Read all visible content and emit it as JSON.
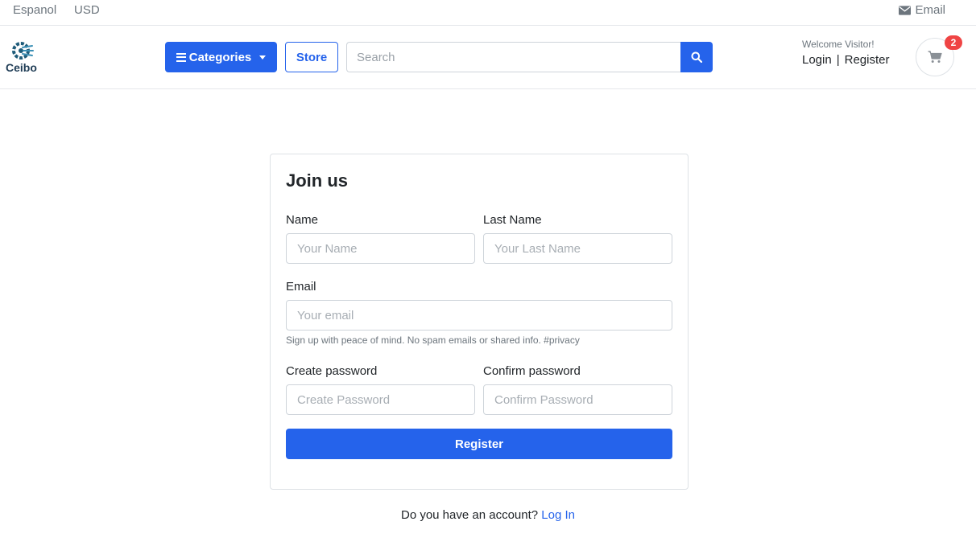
{
  "topbar": {
    "language": "Espanol",
    "currency": "USD",
    "email_label": "Email",
    "email_icon": "envelope-icon"
  },
  "header": {
    "logo_text": "Ceibo",
    "categories_label": "Categories",
    "store_label": "Store",
    "search_placeholder": "Search",
    "welcome_text": "Welcome Visitor!",
    "login_label": "Login",
    "separator": "|",
    "register_label": "Register",
    "cart_count": "2",
    "cart_icon": "shopping-cart-icon"
  },
  "form": {
    "title": "Join us",
    "name_label": "Name",
    "name_placeholder": "Your Name",
    "last_name_label": "Last Name",
    "last_name_placeholder": "Your Last Name",
    "email_label": "Email",
    "email_placeholder": "Your email",
    "email_help": "Sign up with peace of mind. No spam emails or shared info. #privacy",
    "password_label": "Create password",
    "password_placeholder": "Create Password",
    "confirm_label": "Confirm password",
    "confirm_placeholder": "Confirm Password",
    "submit_label": "Register"
  },
  "footer": {
    "question": "Do you have an account?",
    "login_link": "Log In"
  },
  "colors": {
    "primary": "#2563eb",
    "badge": "#ef4444",
    "logo": "#1f5c7a"
  }
}
